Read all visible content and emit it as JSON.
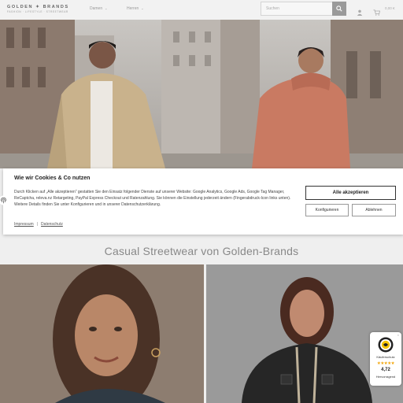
{
  "header": {
    "logo_text": "GOLDEN ✦ BRANDS",
    "logo_tagline": "FASHION · LIFESTYLE · STREETWEAR",
    "nav": [
      {
        "label": "Damen"
      },
      {
        "label": "Herren"
      }
    ],
    "search_placeholder": "Suchen",
    "cart_total": "0,00 €"
  },
  "hero": {
    "image": "two models in jackets on a city street"
  },
  "section": {
    "title": "Casual Streetwear von Golden-Brands"
  },
  "cookie": {
    "title": "Wie wir Cookies & Co nutzen",
    "text": "Durch Klicken auf „Alle akzeptieren“ gestatten Sie den Einsatz folgender Dienste auf unserer Website: Google Analytics, Google Ads, Google Tag Manager, ReCaptcha, releva.nz Retargeting, PayPal Express Checkout und Ratenzahlung. Sie können die Einstellung jederzeit ändern (Fingerabdruck-Icon links unten). Weitere Details finden Sie unter Konfigurieren und in unserer Datenschutzerklärung.",
    "accept_label": "Alle akzeptieren",
    "configure_label": "Konfigurieren",
    "reject_label": "Ablehnen",
    "link_imprint": "Impressum",
    "link_privacy": "Datenschutz",
    "link_separator": "|"
  },
  "trust_badge": {
    "label": "Käuferschutz",
    "stars": "★★★★★",
    "score": "4,72",
    "grade": "Hervorragend",
    "close": "×",
    "star_color": "#f2a60c"
  },
  "colors": {
    "hero_jacket_left": "#c9b28c",
    "hero_jacket_right": "#c97a62",
    "search_button": "#9a9a9a"
  }
}
